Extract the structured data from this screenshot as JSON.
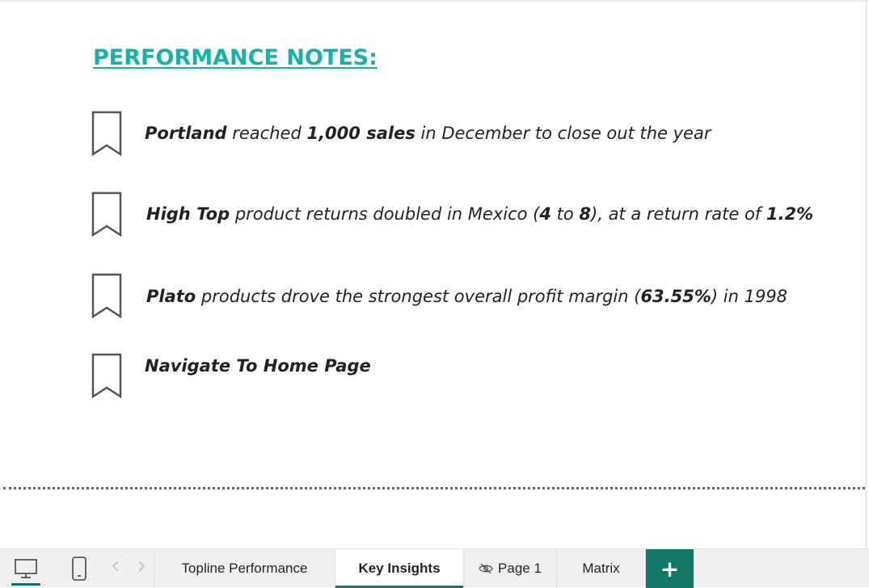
{
  "title": "PERFORMANCE NOTES:",
  "notes": [
    {
      "parts": [
        {
          "text": "Portland",
          "bold": true
        },
        {
          "text": " reached ",
          "bold": false
        },
        {
          "text": "1,000 sales",
          "bold": true
        },
        {
          "text": " in December to close out the year",
          "bold": false
        }
      ]
    },
    {
      "parts": [
        {
          "text": "High Top",
          "bold": true
        },
        {
          "text": " product returns doubled in Mexico (",
          "bold": false
        },
        {
          "text": "4",
          "bold": true
        },
        {
          "text": " to ",
          "bold": false
        },
        {
          "text": "8",
          "bold": true
        },
        {
          "text": "), at a return rate of ",
          "bold": false
        },
        {
          "text": "1.2%",
          "bold": true
        }
      ]
    },
    {
      "parts": [
        {
          "text": "Plato",
          "bold": true
        },
        {
          "text": " products drove the strongest overall profit margin (",
          "bold": false
        },
        {
          "text": "63.55%",
          "bold": true
        },
        {
          "text": ") in 1998",
          "bold": false
        }
      ]
    },
    {
      "parts": [
        {
          "text": "Navigate To Home Page",
          "bold": true
        }
      ]
    }
  ],
  "icons": {
    "bookmark": "bookmark-icon",
    "desktop": "desktop-icon",
    "mobile": "mobile-icon",
    "prev": "chevron-left-icon",
    "next": "chevron-right-icon",
    "hidden": "eye-hidden-icon",
    "add": "plus-icon"
  },
  "tabs": {
    "topline": "Topline Performance",
    "key_insights": "Key Insights",
    "page1": "Page 1",
    "matrix": "Matrix",
    "active": "Key Insights"
  },
  "add_label": "+",
  "colors": {
    "title": "#14b3a8",
    "accent": "#117865",
    "text": "#222222"
  }
}
